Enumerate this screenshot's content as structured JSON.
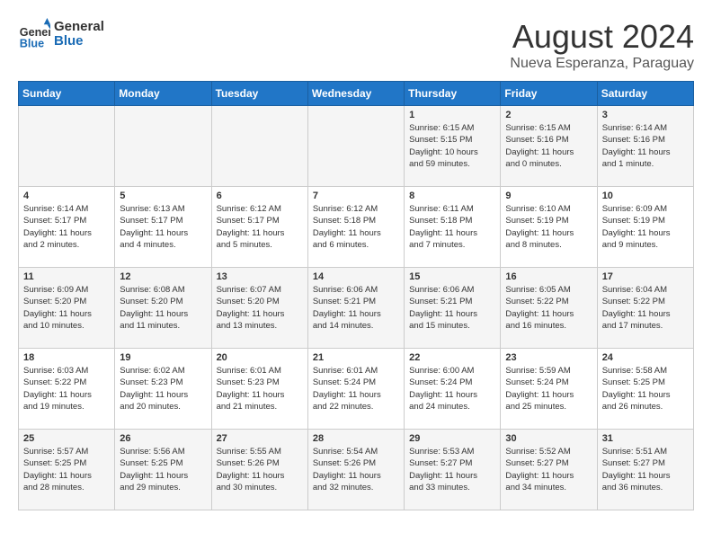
{
  "header": {
    "logo_line1": "General",
    "logo_line2": "Blue",
    "main_title": "August 2024",
    "subtitle": "Nueva Esperanza, Paraguay"
  },
  "calendar": {
    "days_of_week": [
      "Sunday",
      "Monday",
      "Tuesday",
      "Wednesday",
      "Thursday",
      "Friday",
      "Saturday"
    ],
    "weeks": [
      [
        {
          "day": "",
          "info": ""
        },
        {
          "day": "",
          "info": ""
        },
        {
          "day": "",
          "info": ""
        },
        {
          "day": "",
          "info": ""
        },
        {
          "day": "1",
          "info": "Sunrise: 6:15 AM\nSunset: 5:15 PM\nDaylight: 10 hours\nand 59 minutes."
        },
        {
          "day": "2",
          "info": "Sunrise: 6:15 AM\nSunset: 5:16 PM\nDaylight: 11 hours\nand 0 minutes."
        },
        {
          "day": "3",
          "info": "Sunrise: 6:14 AM\nSunset: 5:16 PM\nDaylight: 11 hours\nand 1 minute."
        }
      ],
      [
        {
          "day": "4",
          "info": "Sunrise: 6:14 AM\nSunset: 5:17 PM\nDaylight: 11 hours\nand 2 minutes."
        },
        {
          "day": "5",
          "info": "Sunrise: 6:13 AM\nSunset: 5:17 PM\nDaylight: 11 hours\nand 4 minutes."
        },
        {
          "day": "6",
          "info": "Sunrise: 6:12 AM\nSunset: 5:17 PM\nDaylight: 11 hours\nand 5 minutes."
        },
        {
          "day": "7",
          "info": "Sunrise: 6:12 AM\nSunset: 5:18 PM\nDaylight: 11 hours\nand 6 minutes."
        },
        {
          "day": "8",
          "info": "Sunrise: 6:11 AM\nSunset: 5:18 PM\nDaylight: 11 hours\nand 7 minutes."
        },
        {
          "day": "9",
          "info": "Sunrise: 6:10 AM\nSunset: 5:19 PM\nDaylight: 11 hours\nand 8 minutes."
        },
        {
          "day": "10",
          "info": "Sunrise: 6:09 AM\nSunset: 5:19 PM\nDaylight: 11 hours\nand 9 minutes."
        }
      ],
      [
        {
          "day": "11",
          "info": "Sunrise: 6:09 AM\nSunset: 5:20 PM\nDaylight: 11 hours\nand 10 minutes."
        },
        {
          "day": "12",
          "info": "Sunrise: 6:08 AM\nSunset: 5:20 PM\nDaylight: 11 hours\nand 11 minutes."
        },
        {
          "day": "13",
          "info": "Sunrise: 6:07 AM\nSunset: 5:20 PM\nDaylight: 11 hours\nand 13 minutes."
        },
        {
          "day": "14",
          "info": "Sunrise: 6:06 AM\nSunset: 5:21 PM\nDaylight: 11 hours\nand 14 minutes."
        },
        {
          "day": "15",
          "info": "Sunrise: 6:06 AM\nSunset: 5:21 PM\nDaylight: 11 hours\nand 15 minutes."
        },
        {
          "day": "16",
          "info": "Sunrise: 6:05 AM\nSunset: 5:22 PM\nDaylight: 11 hours\nand 16 minutes."
        },
        {
          "day": "17",
          "info": "Sunrise: 6:04 AM\nSunset: 5:22 PM\nDaylight: 11 hours\nand 17 minutes."
        }
      ],
      [
        {
          "day": "18",
          "info": "Sunrise: 6:03 AM\nSunset: 5:22 PM\nDaylight: 11 hours\nand 19 minutes."
        },
        {
          "day": "19",
          "info": "Sunrise: 6:02 AM\nSunset: 5:23 PM\nDaylight: 11 hours\nand 20 minutes."
        },
        {
          "day": "20",
          "info": "Sunrise: 6:01 AM\nSunset: 5:23 PM\nDaylight: 11 hours\nand 21 minutes."
        },
        {
          "day": "21",
          "info": "Sunrise: 6:01 AM\nSunset: 5:24 PM\nDaylight: 11 hours\nand 22 minutes."
        },
        {
          "day": "22",
          "info": "Sunrise: 6:00 AM\nSunset: 5:24 PM\nDaylight: 11 hours\nand 24 minutes."
        },
        {
          "day": "23",
          "info": "Sunrise: 5:59 AM\nSunset: 5:24 PM\nDaylight: 11 hours\nand 25 minutes."
        },
        {
          "day": "24",
          "info": "Sunrise: 5:58 AM\nSunset: 5:25 PM\nDaylight: 11 hours\nand 26 minutes."
        }
      ],
      [
        {
          "day": "25",
          "info": "Sunrise: 5:57 AM\nSunset: 5:25 PM\nDaylight: 11 hours\nand 28 minutes."
        },
        {
          "day": "26",
          "info": "Sunrise: 5:56 AM\nSunset: 5:25 PM\nDaylight: 11 hours\nand 29 minutes."
        },
        {
          "day": "27",
          "info": "Sunrise: 5:55 AM\nSunset: 5:26 PM\nDaylight: 11 hours\nand 30 minutes."
        },
        {
          "day": "28",
          "info": "Sunrise: 5:54 AM\nSunset: 5:26 PM\nDaylight: 11 hours\nand 32 minutes."
        },
        {
          "day": "29",
          "info": "Sunrise: 5:53 AM\nSunset: 5:27 PM\nDaylight: 11 hours\nand 33 minutes."
        },
        {
          "day": "30",
          "info": "Sunrise: 5:52 AM\nSunset: 5:27 PM\nDaylight: 11 hours\nand 34 minutes."
        },
        {
          "day": "31",
          "info": "Sunrise: 5:51 AM\nSunset: 5:27 PM\nDaylight: 11 hours\nand 36 minutes."
        }
      ]
    ]
  }
}
